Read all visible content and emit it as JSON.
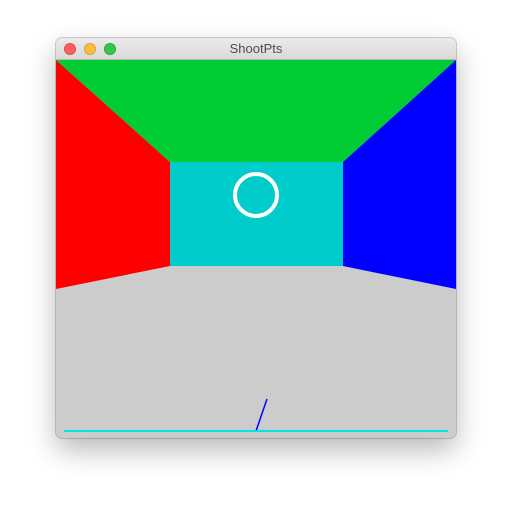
{
  "window": {
    "title": "ShootPts"
  },
  "scene": {
    "colors": {
      "floor": "#cccccc",
      "left_wall": "#ff0000",
      "ceiling": "#00cc33",
      "right_wall": "#0000ff",
      "back_wall": "#00cccc",
      "target_ring": "#ffffff",
      "aim_line": "#0000ff",
      "ground_line": "#00e5e5"
    },
    "target_icon": "ring-target",
    "aim_icon": "aim-line"
  }
}
